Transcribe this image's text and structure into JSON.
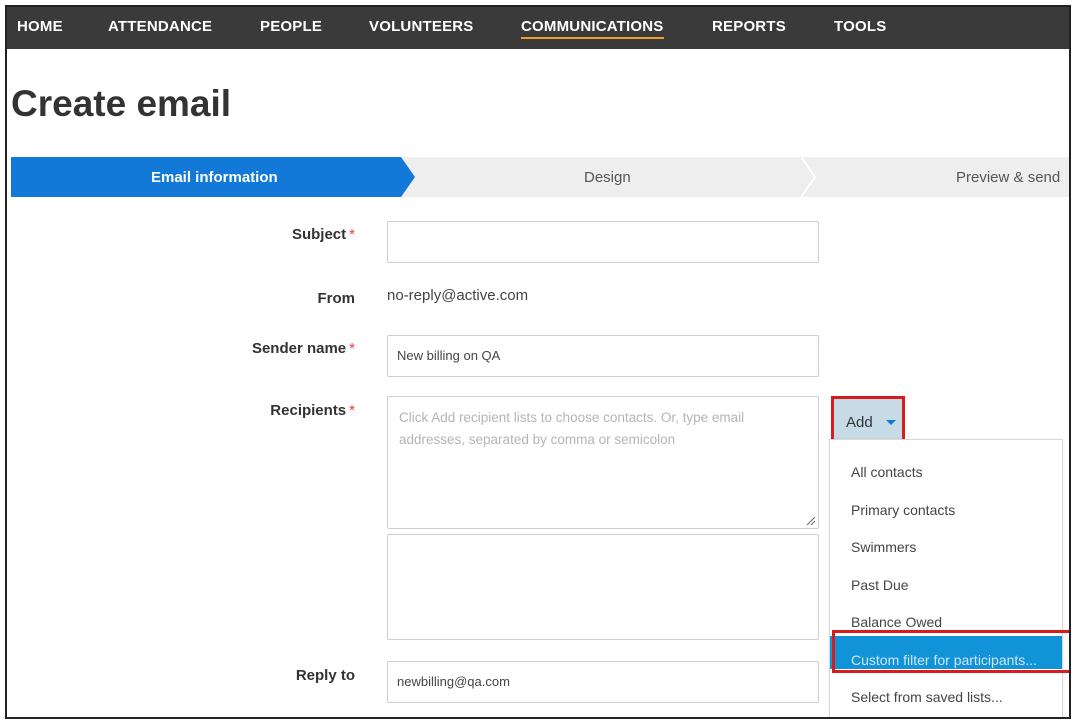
{
  "nav": {
    "items": [
      {
        "label": "HOME"
      },
      {
        "label": "ATTENDANCE"
      },
      {
        "label": "PEOPLE"
      },
      {
        "label": "VOLUNTEERS"
      },
      {
        "label": "COMMUNICATIONS",
        "active": true
      },
      {
        "label": "REPORTS"
      },
      {
        "label": "TOOLS"
      }
    ]
  },
  "page": {
    "title": "Create email"
  },
  "stepper": {
    "steps": [
      {
        "label": "Email information",
        "active": true
      },
      {
        "label": "Design"
      },
      {
        "label": "Preview & send"
      }
    ]
  },
  "form": {
    "required_mark": "*",
    "subject": {
      "label": "Subject",
      "value": ""
    },
    "from": {
      "label": "From",
      "value": "no-reply@active.com"
    },
    "sender_name": {
      "label": "Sender name",
      "value": "New billing on QA"
    },
    "recipients": {
      "label": "Recipients",
      "placeholder": "Click Add recipient lists to choose contacts. Or, type email addresses, separated by comma or semicolon",
      "value": ""
    },
    "reply_to": {
      "label": "Reply to",
      "value": "newbilling@qa.com"
    }
  },
  "add_button": {
    "label": "Add"
  },
  "dropdown": {
    "items": [
      {
        "label": "All contacts"
      },
      {
        "label": "Primary contacts"
      },
      {
        "label": "Swimmers"
      },
      {
        "label": "Past Due"
      },
      {
        "label": "Balance Owed"
      },
      {
        "label": "Custom filter for participants...",
        "highlighted": true
      },
      {
        "label": "Select from saved lists..."
      }
    ]
  },
  "colors": {
    "nav_bg": "#3a3a3a",
    "accent_blue": "#1279d8",
    "nav_active_underline": "#f0a030",
    "highlight_outline": "#d81b1b",
    "dropdown_highlight": "#1193d8"
  }
}
